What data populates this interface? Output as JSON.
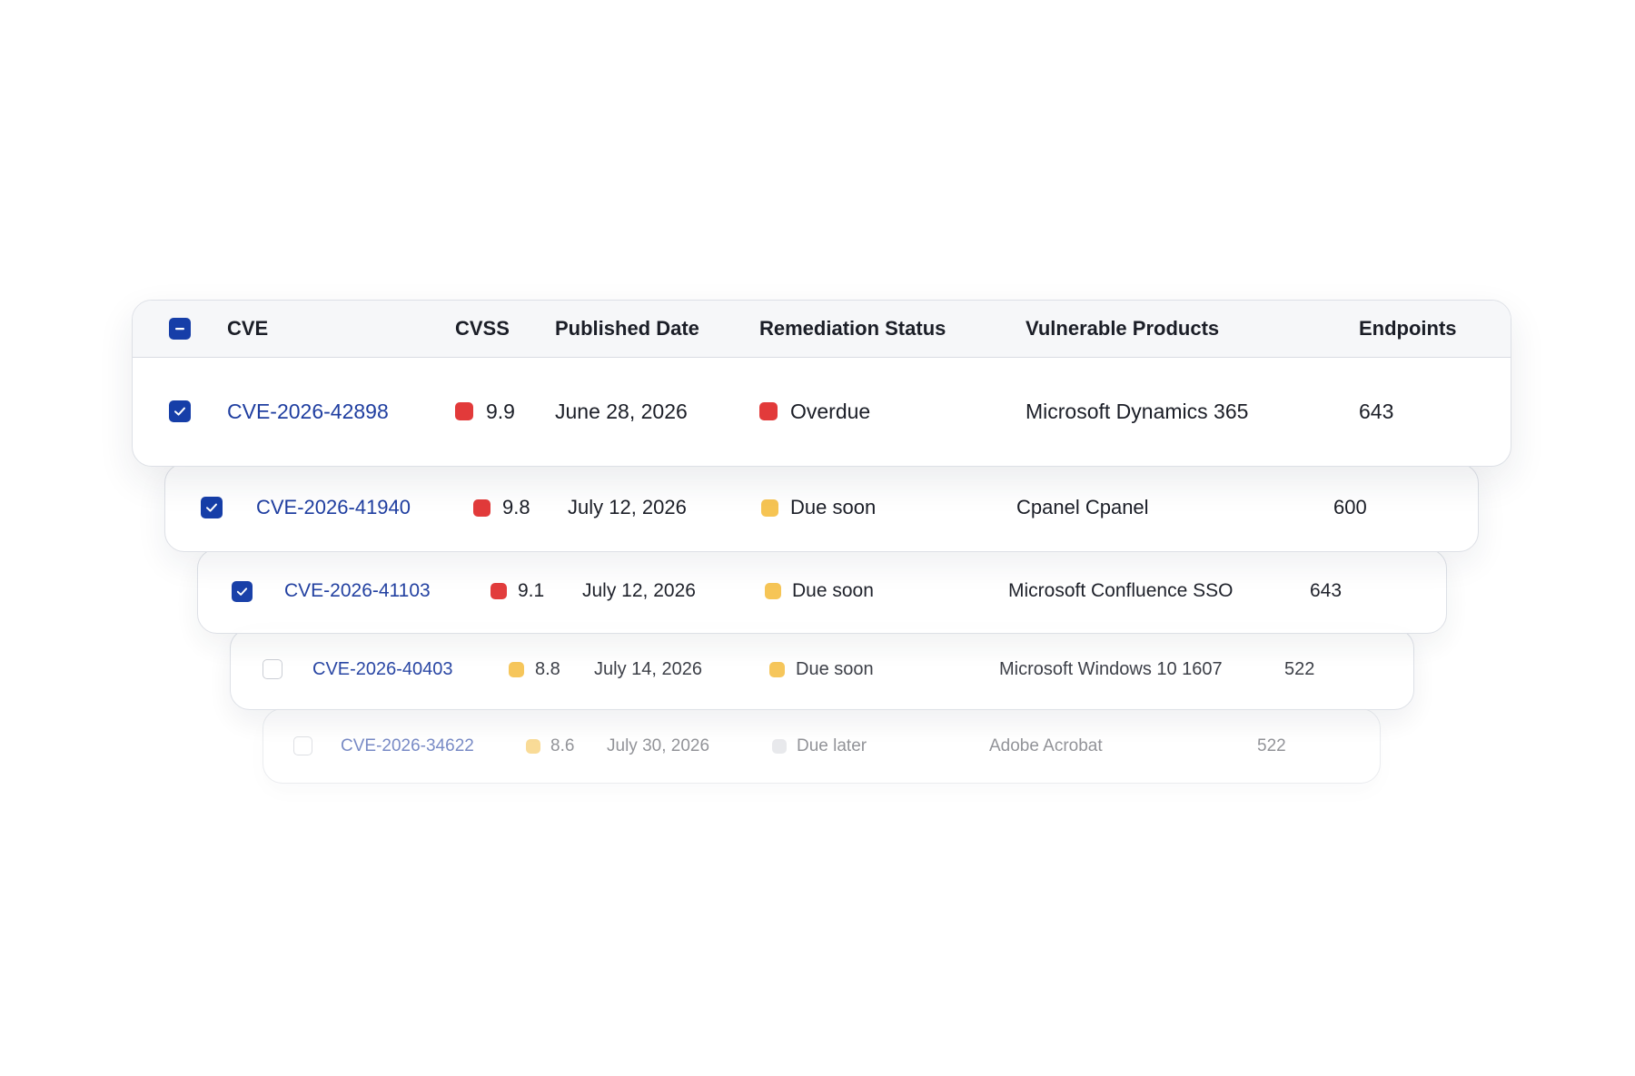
{
  "table": {
    "header": {
      "select_all_state": "indeterminate",
      "columns": [
        "CVE",
        "CVSS",
        "Published Date",
        "Remediation Status",
        "Vulnerable Products",
        "Endpoints"
      ]
    },
    "rows": [
      {
        "checked": true,
        "cve": "CVE-2026-42898",
        "cvss": "9.9",
        "cvss_color": "#e23a3a",
        "published": "June 28, 2026",
        "status": "Overdue",
        "status_color": "#e23a3a",
        "product": "Microsoft Dynamics 365",
        "endpoints": "643"
      },
      {
        "checked": true,
        "cve": "CVE-2026-41940",
        "cvss": "9.8",
        "cvss_color": "#e23a3a",
        "published": "July 12, 2026",
        "status": "Due soon",
        "status_color": "#f6c453",
        "product": "Cpanel Cpanel",
        "endpoints": "600"
      },
      {
        "checked": true,
        "cve": "CVE-2026-41103",
        "cvss": "9.1",
        "cvss_color": "#e23a3a",
        "published": "July 12, 2026",
        "status": "Due soon",
        "status_color": "#f6c453",
        "product": "Microsoft Confluence SSO",
        "endpoints": "643"
      },
      {
        "checked": false,
        "cve": "CVE-2026-40403",
        "cvss": "8.8",
        "cvss_color": "#f6c453",
        "published": "July 14, 2026",
        "status": "Due soon",
        "status_color": "#f6c453",
        "product": "Microsoft Windows 10 1607",
        "endpoints": "522"
      },
      {
        "checked": false,
        "cve": "CVE-2026-34622",
        "cvss": "8.6",
        "cvss_color": "#f6c453",
        "published": "July 30, 2026",
        "status": "Due later",
        "status_color": "#d9dbe0",
        "product": "Adobe Acrobat",
        "endpoints": "522"
      }
    ]
  }
}
